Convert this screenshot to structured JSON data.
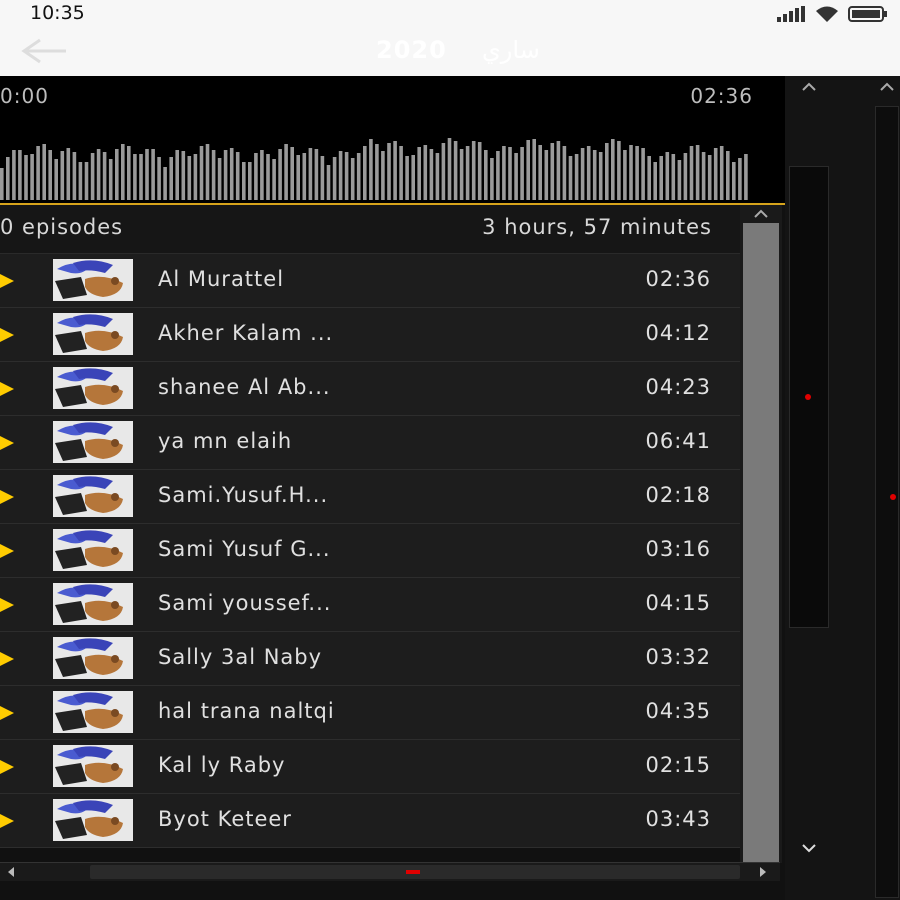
{
  "status": {
    "time": "10:35"
  },
  "appbar": {
    "title": "2020",
    "subtitle": "ساري"
  },
  "player": {
    "start_time": "0:00",
    "end_time": "02:36"
  },
  "summary": {
    "episodes": "0 episodes",
    "total": "3 hours, 57 minutes"
  },
  "episodes": [
    {
      "name": "Al Murattel",
      "duration": "02:36"
    },
    {
      "name": "Akher Kalam ...",
      "duration": "04:12"
    },
    {
      "name": "shanee Al Ab...",
      "duration": "04:23"
    },
    {
      "name": "ya mn elaih",
      "duration": "06:41"
    },
    {
      "name": "Sami.Yusuf.H...",
      "duration": "02:18"
    },
    {
      "name": "Sami Yusuf G...",
      "duration": "03:16"
    },
    {
      "name": "Sami youssef...",
      "duration": "04:15"
    },
    {
      "name": "Sally 3al Naby",
      "duration": "03:32"
    },
    {
      "name": "hal trana naltqi",
      "duration": "04:35"
    },
    {
      "name": "Kal ly Raby",
      "duration": "02:15"
    },
    {
      "name": "Byot Keteer",
      "duration": "03:43"
    }
  ],
  "colors": {
    "accent": "#ffcc00",
    "marker": "#e00000"
  }
}
